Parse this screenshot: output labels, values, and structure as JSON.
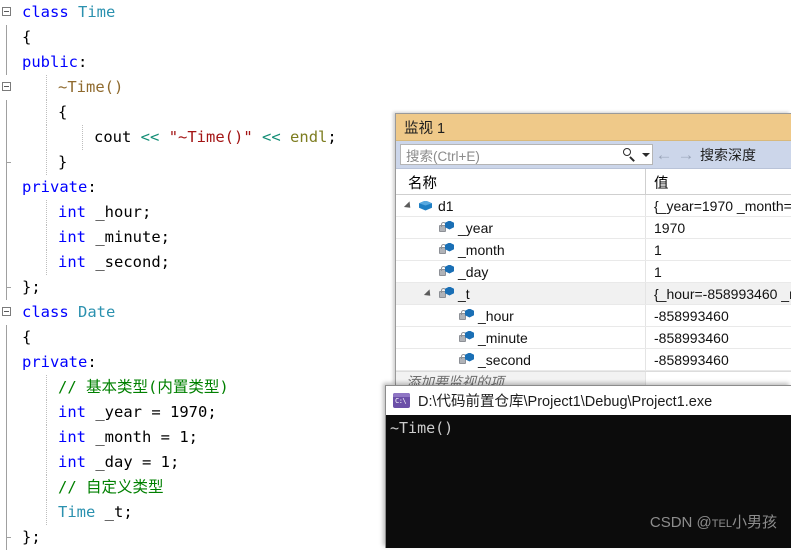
{
  "editor": {
    "lines": [
      {
        "indent": 0,
        "margin": "box-start",
        "tokens": [
          {
            "t": "class",
            "c": "kw"
          },
          {
            "t": " ",
            "c": "ident"
          },
          {
            "t": "Time",
            "c": "type"
          }
        ]
      },
      {
        "indent": 0,
        "margin": "bar",
        "tokens": [
          {
            "t": "{",
            "c": "ident"
          }
        ]
      },
      {
        "indent": 0,
        "margin": "bar",
        "tokens": [
          {
            "t": "public",
            "c": "kw"
          },
          {
            "t": ":",
            "c": "ident"
          }
        ]
      },
      {
        "indent": 1,
        "margin": "box-inner",
        "guide": 1,
        "tokens": [
          {
            "t": "~Time()",
            "c": "func"
          }
        ]
      },
      {
        "indent": 1,
        "margin": "bar",
        "guide": 1,
        "tokens": [
          {
            "t": "{",
            "c": "ident"
          }
        ]
      },
      {
        "indent": 2,
        "margin": "bar",
        "guide": 2,
        "tokens": [
          {
            "t": "cout",
            "c": "ident"
          },
          {
            "t": " ",
            "c": "ident"
          },
          {
            "t": "<<",
            "c": "op"
          },
          {
            "t": " ",
            "c": "ident"
          },
          {
            "t": "\"~Time()\"",
            "c": "str"
          },
          {
            "t": " ",
            "c": "ident"
          },
          {
            "t": "<<",
            "c": "op"
          },
          {
            "t": " ",
            "c": "ident"
          },
          {
            "t": "endl",
            "c": "olive"
          },
          {
            "t": ";",
            "c": "ident"
          }
        ]
      },
      {
        "indent": 1,
        "margin": "bar-end",
        "guide": 1,
        "tokens": [
          {
            "t": "}",
            "c": "ident"
          }
        ]
      },
      {
        "indent": 0,
        "margin": "bar",
        "tokens": [
          {
            "t": "private",
            "c": "kw"
          },
          {
            "t": ":",
            "c": "ident"
          }
        ]
      },
      {
        "indent": 1,
        "margin": "bar",
        "guide": 1,
        "tokens": [
          {
            "t": "int",
            "c": "kw"
          },
          {
            "t": " _hour;",
            "c": "ident"
          }
        ]
      },
      {
        "indent": 1,
        "margin": "bar",
        "guide": 1,
        "tokens": [
          {
            "t": "int",
            "c": "kw"
          },
          {
            "t": " _minute;",
            "c": "ident"
          }
        ]
      },
      {
        "indent": 1,
        "margin": "bar",
        "guide": 1,
        "tokens": [
          {
            "t": "int",
            "c": "kw"
          },
          {
            "t": " _second;",
            "c": "ident"
          }
        ]
      },
      {
        "indent": 0,
        "margin": "bar-end",
        "tokens": [
          {
            "t": "};",
            "c": "ident"
          }
        ]
      },
      {
        "indent": 0,
        "margin": "box-start",
        "tokens": [
          {
            "t": "class",
            "c": "kw"
          },
          {
            "t": " ",
            "c": "ident"
          },
          {
            "t": "Date",
            "c": "type"
          }
        ]
      },
      {
        "indent": 0,
        "margin": "bar",
        "tokens": [
          {
            "t": "{",
            "c": "ident"
          }
        ]
      },
      {
        "indent": 0,
        "margin": "bar",
        "tokens": [
          {
            "t": "private",
            "c": "kw"
          },
          {
            "t": ":",
            "c": "ident"
          }
        ]
      },
      {
        "indent": 1,
        "margin": "bar",
        "guide": 1,
        "tokens": [
          {
            "t": "// 基本类型(内置类型)",
            "c": "cmt"
          }
        ]
      },
      {
        "indent": 1,
        "margin": "bar",
        "guide": 1,
        "tokens": [
          {
            "t": "int",
            "c": "kw"
          },
          {
            "t": " _year = ",
            "c": "ident"
          },
          {
            "t": "1970",
            "c": "num"
          },
          {
            "t": ";",
            "c": "ident"
          }
        ]
      },
      {
        "indent": 1,
        "margin": "bar",
        "guide": 1,
        "tokens": [
          {
            "t": "int",
            "c": "kw"
          },
          {
            "t": " _month = ",
            "c": "ident"
          },
          {
            "t": "1",
            "c": "num"
          },
          {
            "t": ";",
            "c": "ident"
          }
        ]
      },
      {
        "indent": 1,
        "margin": "bar",
        "guide": 1,
        "tokens": [
          {
            "t": "int",
            "c": "kw"
          },
          {
            "t": " _day = ",
            "c": "ident"
          },
          {
            "t": "1",
            "c": "num"
          },
          {
            "t": ";",
            "c": "ident"
          }
        ]
      },
      {
        "indent": 1,
        "margin": "bar",
        "guide": 1,
        "tokens": [
          {
            "t": "// 自定义类型",
            "c": "cmt"
          }
        ]
      },
      {
        "indent": 1,
        "margin": "bar",
        "guide": 1,
        "tokens": [
          {
            "t": "Time",
            "c": "type"
          },
          {
            "t": " _t;",
            "c": "ident"
          }
        ]
      },
      {
        "indent": 0,
        "margin": "bar-end",
        "tokens": [
          {
            "t": "};",
            "c": "ident"
          }
        ]
      }
    ]
  },
  "watch": {
    "title": "监视 1",
    "search_placeholder": "搜索(Ctrl+E)",
    "search_icon": "search-icon",
    "dropdown_icon": "chevron-down-icon",
    "back_icon": "←",
    "forward_icon": "→",
    "depth_label": "搜索深度",
    "columns": {
      "name": "名称",
      "value": "值"
    },
    "rows": [
      {
        "indent": 0,
        "twisty": "expanded",
        "icon": "object-icon",
        "name": "d1",
        "value": "{_year=1970 _month=",
        "selected": false
      },
      {
        "indent": 1,
        "twisty": "none",
        "icon": "field-icon",
        "name": "_year",
        "value": "1970",
        "selected": false
      },
      {
        "indent": 1,
        "twisty": "none",
        "icon": "field-icon",
        "name": "_month",
        "value": "1",
        "selected": false
      },
      {
        "indent": 1,
        "twisty": "none",
        "icon": "field-icon",
        "name": "_day",
        "value": "1",
        "selected": false
      },
      {
        "indent": 1,
        "twisty": "expanded",
        "icon": "field-icon",
        "name": "_t",
        "value": "{_hour=-858993460 _m",
        "selected": true
      },
      {
        "indent": 2,
        "twisty": "none",
        "icon": "field-icon",
        "name": "_hour",
        "value": "-858993460",
        "selected": false
      },
      {
        "indent": 2,
        "twisty": "none",
        "icon": "field-icon",
        "name": "_minute",
        "value": "-858993460",
        "selected": false
      },
      {
        "indent": 2,
        "twisty": "none",
        "icon": "field-icon",
        "name": "_second",
        "value": "-858993460",
        "selected": false
      }
    ],
    "add_row_placeholder": "添加要监视的项"
  },
  "console": {
    "icon": "cmd-icon",
    "title": "D:\\代码前置仓库\\Project1\\Debug\\Project1.exe",
    "output": "~Time()",
    "watermark_prefix": "CSDN @",
    "watermark_small": "TEL",
    "watermark_suffix": "小男孩"
  },
  "colors": {
    "keyword": "#0000ff",
    "type": "#2b91af",
    "string": "#a31515",
    "comment": "#008000",
    "function": "#8f6a2e",
    "operator": "#138d75",
    "watch_title_bg": "#efc989",
    "watch_toolbar_bg": "#ccd6ea",
    "console_bg": "#0c0c0c"
  }
}
